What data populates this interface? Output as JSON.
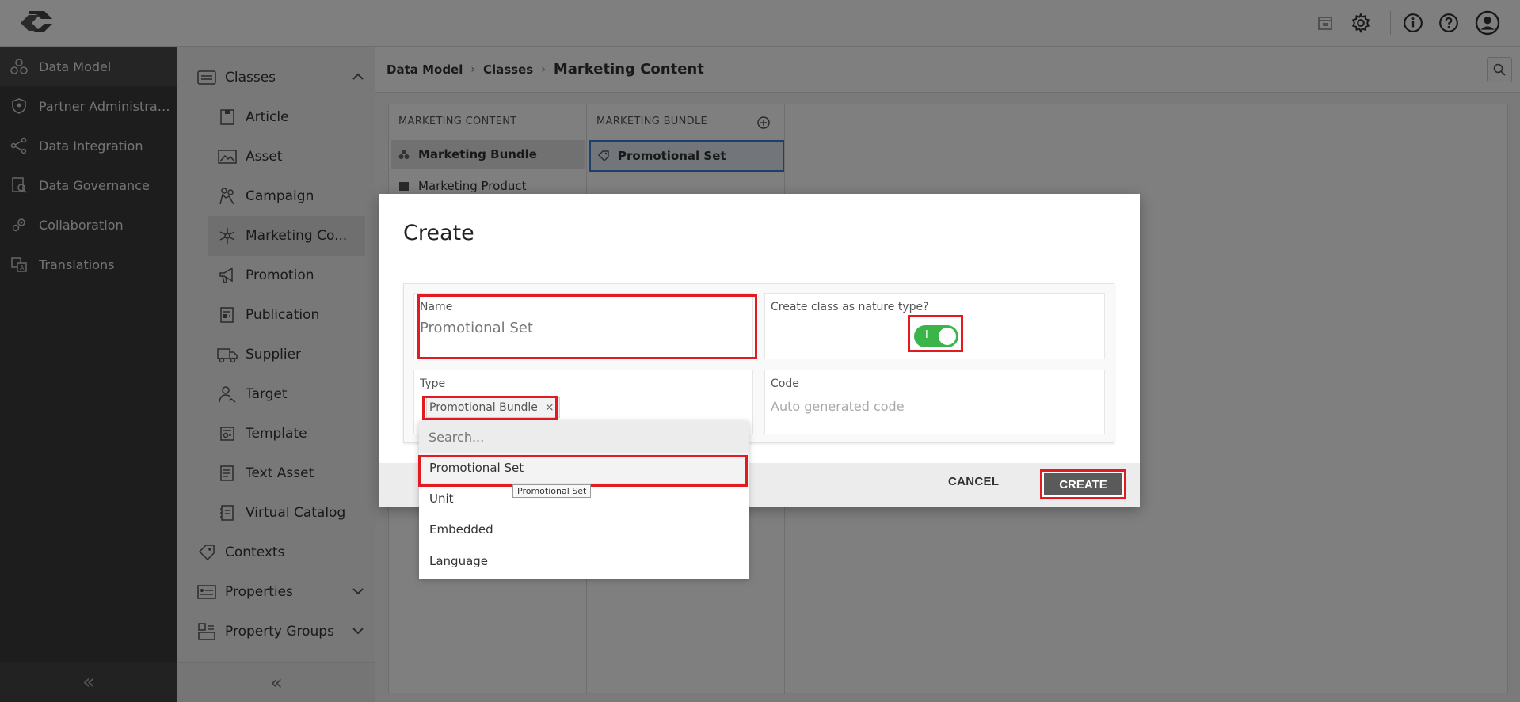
{
  "leftnav": {
    "items": [
      {
        "label": "Data Model",
        "icon": "data-model-icon"
      },
      {
        "label": "Partner Administrati...",
        "icon": "shield-icon"
      },
      {
        "label": "Data Integration",
        "icon": "integration-icon"
      },
      {
        "label": "Data Governance",
        "icon": "governance-icon"
      },
      {
        "label": "Collaboration",
        "icon": "collaboration-icon"
      },
      {
        "label": "Translations",
        "icon": "translations-icon"
      }
    ],
    "collapse": "«"
  },
  "subnav": {
    "items": [
      {
        "label": "Classes",
        "icon": "classes-icon",
        "level": 1
      },
      {
        "label": "Article",
        "icon": "article-icon",
        "level": 2
      },
      {
        "label": "Asset",
        "icon": "asset-icon",
        "level": 2
      },
      {
        "label": "Campaign",
        "icon": "campaign-icon",
        "level": 2
      },
      {
        "label": "Marketing Co...",
        "icon": "marketing-icon",
        "level": 2
      },
      {
        "label": "Promotion",
        "icon": "megaphone-icon",
        "level": 2
      },
      {
        "label": "Publication",
        "icon": "publication-icon",
        "level": 2
      },
      {
        "label": "Supplier",
        "icon": "truck-icon",
        "level": 2
      },
      {
        "label": "Target",
        "icon": "target-icon",
        "level": 2
      },
      {
        "label": "Template",
        "icon": "template-icon",
        "level": 2
      },
      {
        "label": "Text Asset",
        "icon": "text-asset-icon",
        "level": 2
      },
      {
        "label": "Virtual Catalog",
        "icon": "catalog-icon",
        "level": 2
      },
      {
        "label": "Contexts",
        "icon": "tag-icon",
        "level": 1
      },
      {
        "label": "Properties",
        "icon": "properties-icon",
        "level": 1
      },
      {
        "label": "Property Groups",
        "icon": "property-groups-icon",
        "level": 1
      }
    ],
    "collapse": "«"
  },
  "breadcrumb": {
    "items": [
      "Data Model",
      "Classes",
      "Marketing Content"
    ]
  },
  "columns": {
    "col1": {
      "header": "MARKETING CONTENT",
      "rows": [
        "Marketing Bundle",
        "Marketing Product"
      ]
    },
    "col2": {
      "header": "MARKETING BUNDLE",
      "rows": [
        "Promotional Set"
      ]
    }
  },
  "modal": {
    "title": "Create",
    "name_label": "Name",
    "name_value": "Promotional Set",
    "nature_label": "Create class as nature type?",
    "toggle_on_mark": "I",
    "type_label": "Type",
    "type_chip": "Promotional Bundle",
    "chip_remove": "×",
    "code_label": "Code",
    "code_placeholder": "Auto generated code",
    "cancel": "CANCEL",
    "create": "CREATE"
  },
  "dropdown": {
    "search_placeholder": "Search...",
    "options": [
      "Promotional Set",
      "Unit",
      "Embedded",
      "Language"
    ],
    "tooltip": "Promotional Set"
  },
  "colors": {
    "highlight": "#e21b23",
    "toggle_on": "#3bb54a",
    "nav_bg": "#3b3b3b"
  }
}
